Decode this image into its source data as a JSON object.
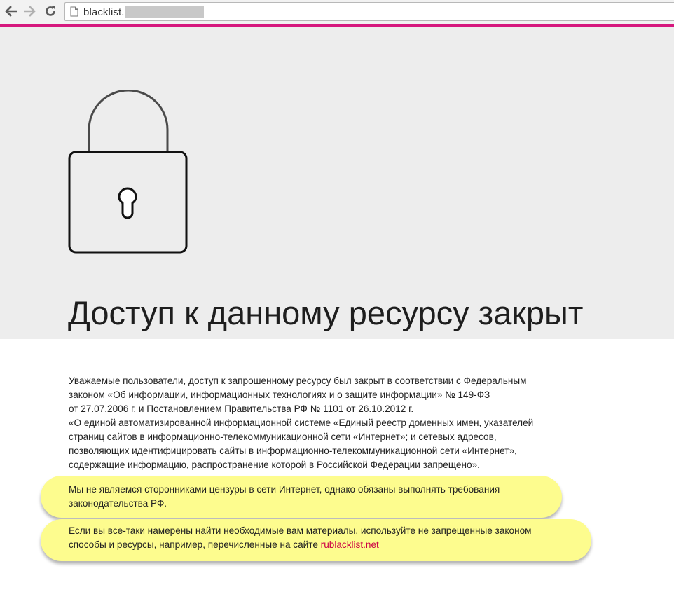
{
  "browser": {
    "url": "blacklist.",
    "accent_color": "#d6187e"
  },
  "hero": {
    "background": "#ededed",
    "icon": "padlock-icon",
    "title": "Доступ к данному ресурсу закрыт"
  },
  "notice": {
    "lines": [
      "Уважаемые пользователи, доступ к запрошенному ресурсу был закрыт в соответствии с Федеральным",
      "законом «Об информации, информационных технологиях и о защите информации» № 149-ФЗ",
      "от 27.07.2006 г. и Постановлением Правительства РФ № 1101 от 26.10.2012 г.",
      "«О единой автоматизированной информационной системе «Единый реестр доменных имен, указателей",
      "страниц сайтов в информационно-телекоммуникационной сети «Интернет»; и сетевых адресов,",
      "позволяющих идентифицировать сайты в информационно-телекоммуникационной сети «Интернет»,",
      "содержащие информацию, распространение которой в Российской Федерации запрещено»."
    ]
  },
  "callouts": {
    "first": {
      "line1": "Мы не являемся сторонниками цензуры в сети Интернет, однако обязаны выполнять требования",
      "line2": "законодательства РФ."
    },
    "second": {
      "line1": "Если вы все-таки намерены найти необходимые вам материалы, используйте не запрещенные законом",
      "line2_prefix": "способы и ресурсы, например, перечисленные на сайте ",
      "link_text": "rublacklist.net"
    },
    "highlight_color": "#fdfc8e",
    "link_color": "#cc0044"
  }
}
